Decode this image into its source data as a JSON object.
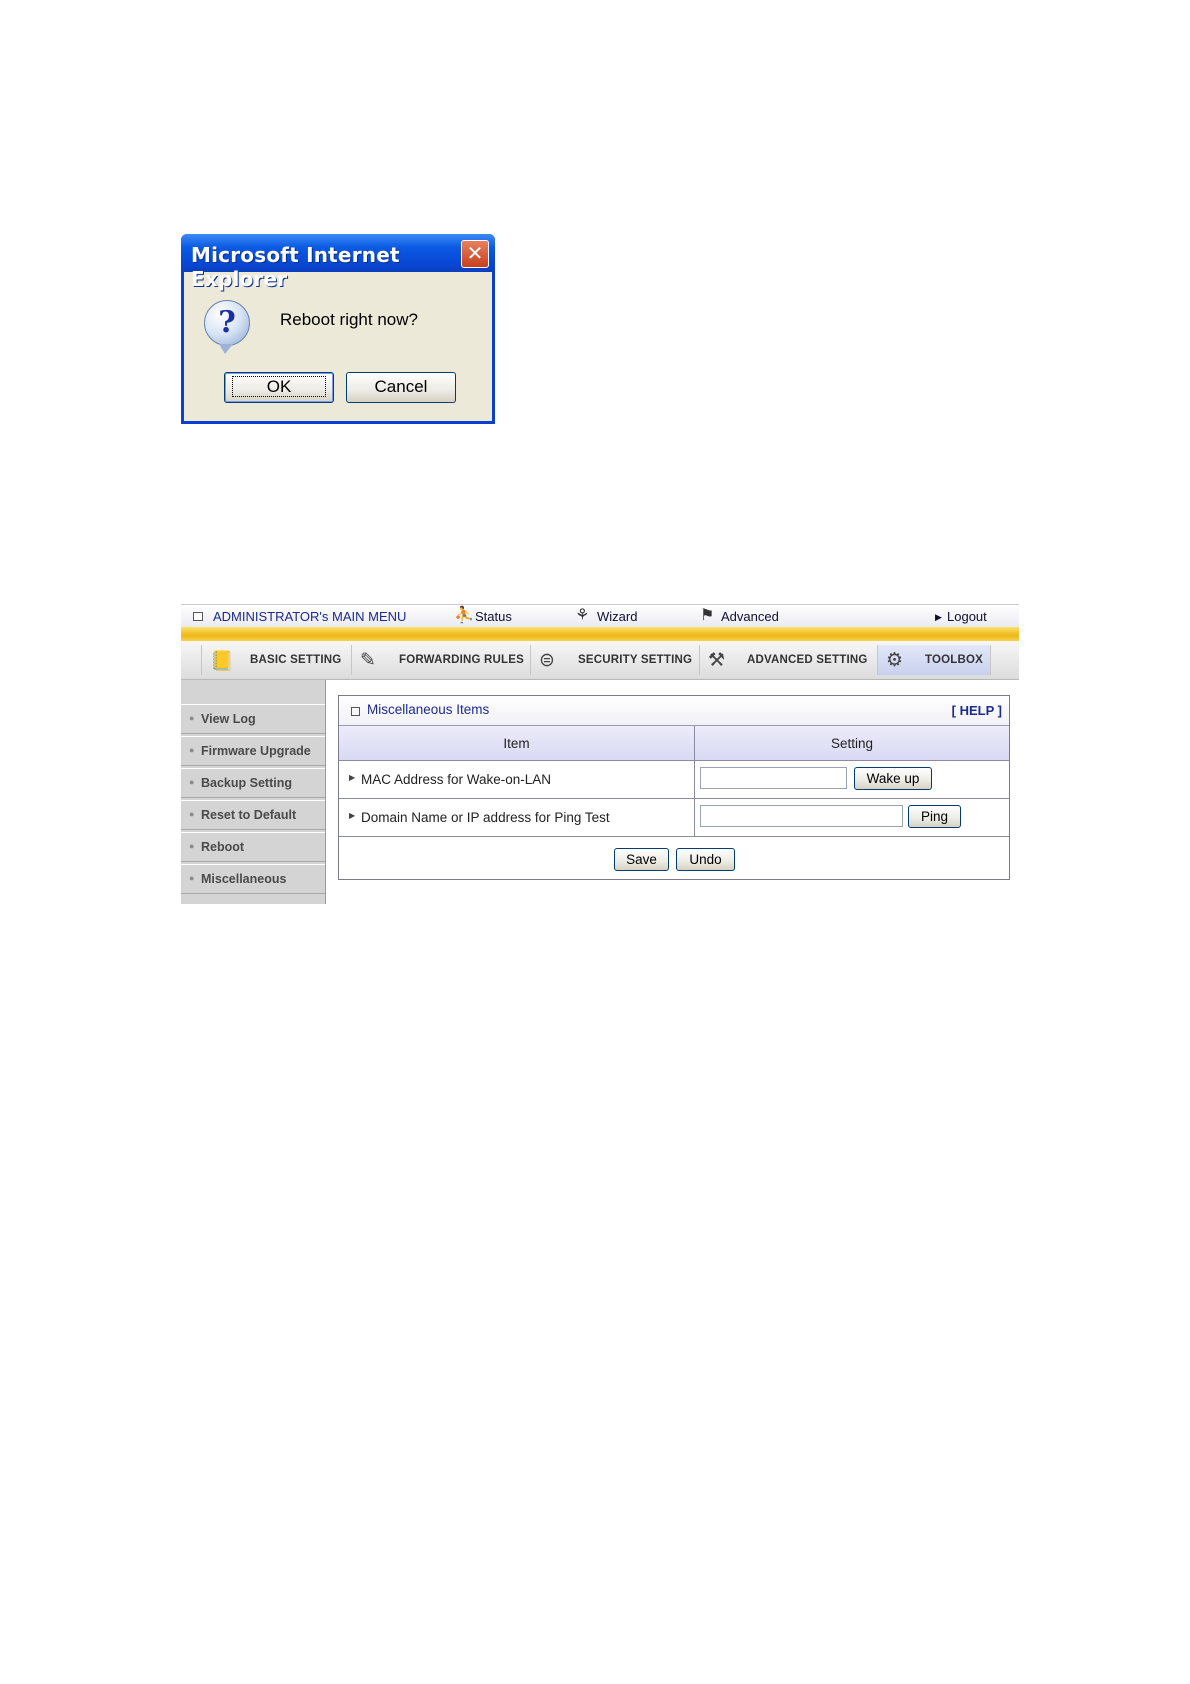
{
  "dialog": {
    "title": "Microsoft Internet Explorer",
    "close_glyph": "✕",
    "icon_glyph": "?",
    "message": "Reboot right now?",
    "ok_label": "OK",
    "cancel_label": "Cancel"
  },
  "topbar": {
    "admin_menu": "ADMINISTRATOR's MAIN MENU",
    "status": "Status",
    "wizard": "Wizard",
    "advanced": "Advanced",
    "logout": "Logout"
  },
  "tabs": [
    {
      "label": "BASIC SETTING",
      "icon": "📒"
    },
    {
      "label": "FORWARDING RULES",
      "icon": "✎"
    },
    {
      "label": "SECURITY SETTING",
      "icon": "⊜"
    },
    {
      "label": "ADVANCED SETTING",
      "icon": "⚒"
    },
    {
      "label": "TOOLBOX",
      "icon": "⚙"
    }
  ],
  "sidebar": {
    "items": [
      "View Log",
      "Firmware Upgrade",
      "Backup Setting",
      "Reset to Default",
      "Reboot",
      "Miscellaneous"
    ]
  },
  "panel": {
    "title": "Miscellaneous Items",
    "help": "[ HELP ]",
    "col_item": "Item",
    "col_setting": "Setting",
    "rows": [
      {
        "label": "MAC Address for Wake-on-LAN",
        "input_value": "",
        "button": "Wake up"
      },
      {
        "label": "Domain Name or IP address for Ping Test",
        "input_value": "",
        "button": "Ping"
      }
    ],
    "save_label": "Save",
    "undo_label": "Undo"
  }
}
